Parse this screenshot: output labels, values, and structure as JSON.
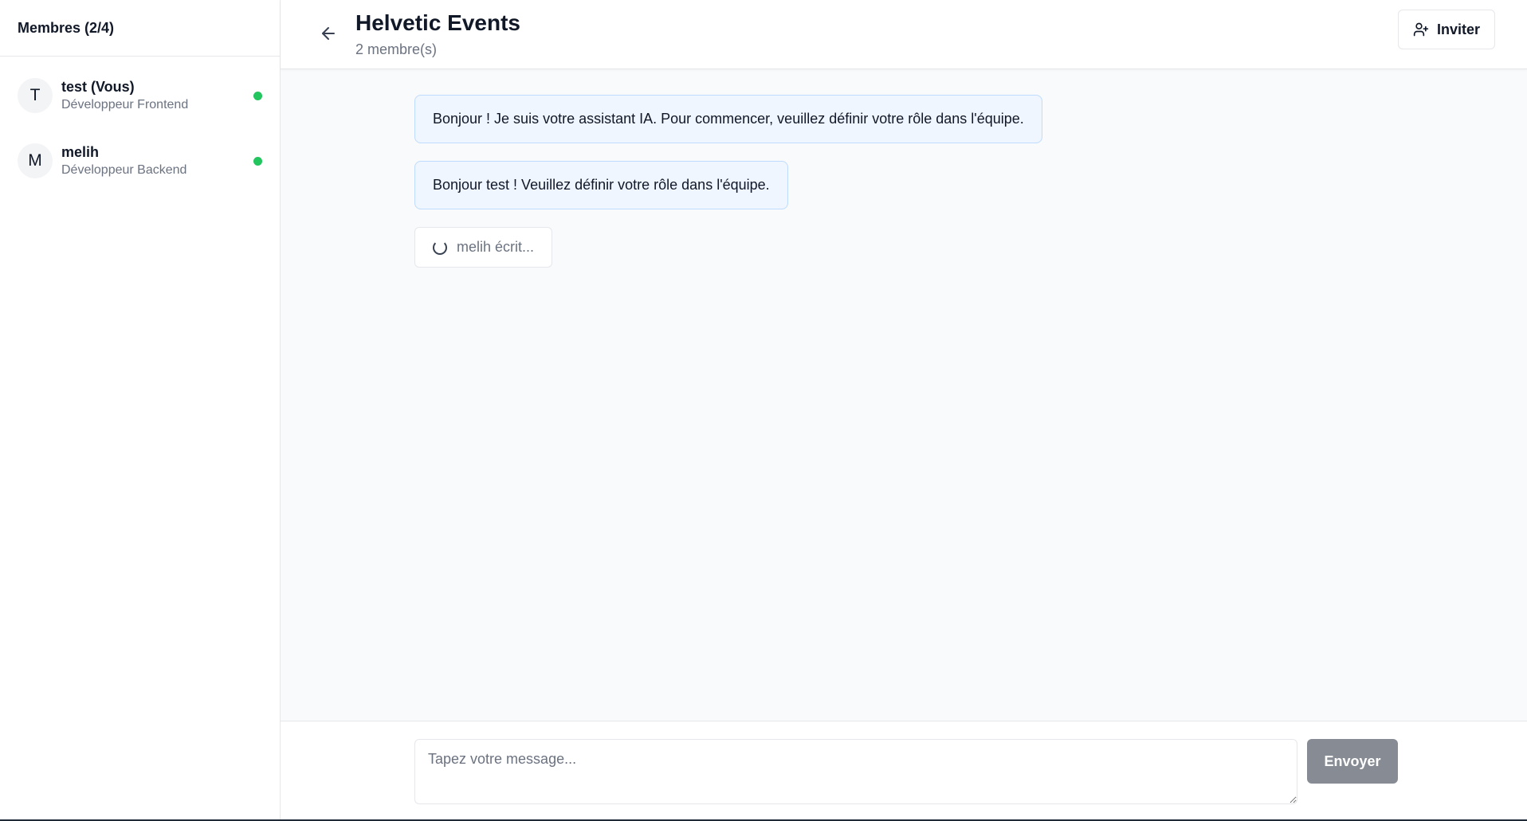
{
  "sidebar": {
    "title": "Membres (2/4)",
    "members": [
      {
        "initial": "T",
        "name": "test (Vous)",
        "role": "Développeur Frontend",
        "online": true
      },
      {
        "initial": "M",
        "name": "melih",
        "role": "Développeur Backend",
        "online": true
      }
    ]
  },
  "header": {
    "title": "Helvetic Events",
    "subtitle": "2 membre(s)",
    "invite_label": "Inviter"
  },
  "messages": [
    {
      "text": "Bonjour ! Je suis votre assistant IA. Pour commencer, veuillez définir votre rôle dans l'équipe."
    },
    {
      "text": "Bonjour test ! Veuillez définir votre rôle dans l'équipe."
    }
  ],
  "typing_indicator": "melih écrit...",
  "composer": {
    "placeholder": "Tapez votre message...",
    "value": "",
    "send_label": "Envoyer"
  },
  "colors": {
    "online": "#22c55e",
    "bubble_bg": "#eff6ff",
    "bubble_border": "#bfdbfe",
    "send_disabled": "#878c94"
  },
  "icons": {
    "back": "arrow-left-icon",
    "invite": "user-plus-icon",
    "typing": "spinner-icon"
  }
}
